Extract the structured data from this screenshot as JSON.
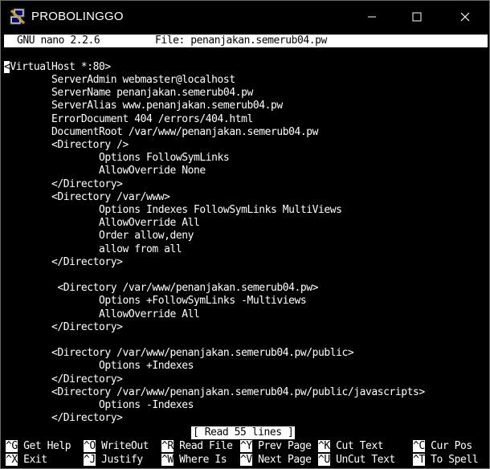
{
  "window": {
    "title": "PROBOLINGGO"
  },
  "nano": {
    "version": "GNU nano 2.2.6",
    "file_label": "File: penanjakan.semerub04.pw",
    "cursor_char": "<",
    "first_line_rest": "VirtualHost *:80>",
    "lines": [
      "        ServerAdmin webmaster@localhost",
      "        ServerName penanjakan.semerub04.pw",
      "        ServerAlias www.penanjakan.semerub04.pw",
      "        ErrorDocument 404 /errors/404.html",
      "        DocumentRoot /var/www/penanjakan.semerub04.pw",
      "        <Directory />",
      "                Options FollowSymLinks",
      "                AllowOverride None",
      "        </Directory>",
      "        <Directory /var/www>",
      "                Options Indexes FollowSymLinks MultiViews",
      "                AllowOverride All",
      "                Order allow,deny",
      "                allow from all",
      "        </Directory>",
      "",
      "         <Directory /var/www/penanjakan.semerub04.pw>",
      "                Options +FollowSymLinks -Multiviews",
      "                AllowOverride All",
      "        </Directory>",
      "",
      "        <Directory /var/www/penanjakan.semerub04.pw/public>",
      "                Options +Indexes",
      "        </Directory>",
      "        <Directory /var/www/penanjakan.semerub04.pw/public/javascripts>",
      "                Options -Indexes",
      "        </Directory>"
    ],
    "status": "[ Read 55 lines ]",
    "shortcuts_row1": [
      {
        "key": "^G",
        "label": "Get Help"
      },
      {
        "key": "^O",
        "label": "WriteOut"
      },
      {
        "key": "^R",
        "label": "Read File"
      },
      {
        "key": "^Y",
        "label": "Prev Page"
      },
      {
        "key": "^K",
        "label": "Cut Text"
      },
      {
        "key": "^C",
        "label": "Cur Pos"
      }
    ],
    "shortcuts_row2": [
      {
        "key": "^X",
        "label": "Exit"
      },
      {
        "key": "^J",
        "label": "Justify"
      },
      {
        "key": "^W",
        "label": "Where Is"
      },
      {
        "key": "^V",
        "label": "Next Page"
      },
      {
        "key": "^U",
        "label": "UnCut Text"
      },
      {
        "key": "^T",
        "label": "To Spell"
      }
    ]
  },
  "colors": {
    "titlebar_bg": "#000000",
    "terminal_bg": "#000000",
    "terminal_fg": "#ffffff",
    "inverse_bg": "#ffffff",
    "inverse_fg": "#000000"
  },
  "icons": {
    "app": "putty-icon",
    "minimize": "minimize-icon",
    "maximize": "maximize-icon",
    "close": "close-icon"
  }
}
